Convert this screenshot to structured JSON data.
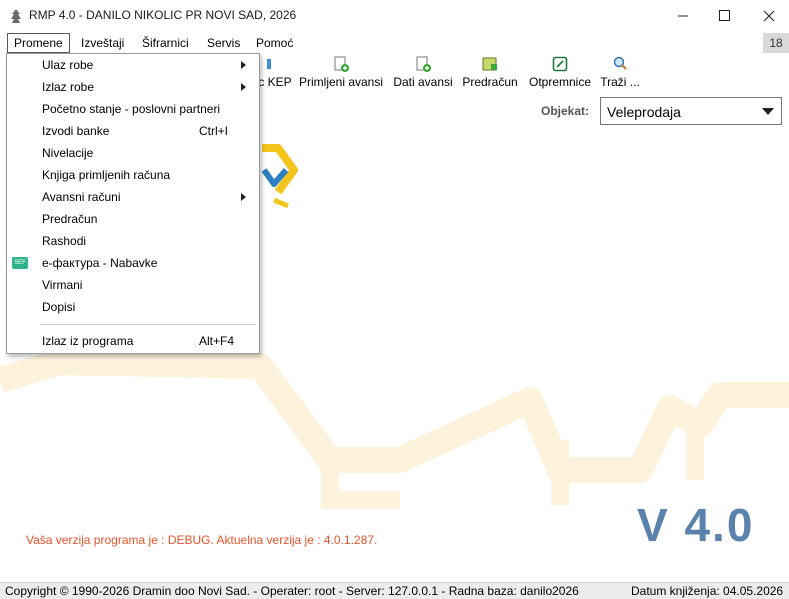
{
  "window": {
    "title": "RMP 4.0 - DANILO NIKOLIC PR NOVI SAD, 2026",
    "minimize_icon": "minimize-icon",
    "maximize_icon": "maximize-icon",
    "close_icon": "close-icon"
  },
  "menubar": {
    "items": [
      {
        "label": "Promene",
        "active": true
      },
      {
        "label": "Izveštaji"
      },
      {
        "label": "Šifrarnici"
      },
      {
        "label": "Servis"
      },
      {
        "label": "Pomoć"
      }
    ],
    "counter": "18"
  },
  "toolbar": {
    "items": [
      {
        "label": "c KEP",
        "icon": "kep-icon"
      },
      {
        "label": "Primljeni avansi",
        "icon": "document-add-icon"
      },
      {
        "label": "Dati avansi",
        "icon": "document-add-icon"
      },
      {
        "label": "Predračun",
        "icon": "invoice-icon"
      },
      {
        "label": "Otpremnice",
        "icon": "delivery-note-icon"
      },
      {
        "label": "Traži ...",
        "icon": "search-icon"
      }
    ]
  },
  "object_selector": {
    "label": "Objekat:",
    "value": "Veleprodaja"
  },
  "dropdown": {
    "items": [
      {
        "label": "Ulaz robe",
        "submenu": true
      },
      {
        "label": "Izlaz robe",
        "submenu": true
      },
      {
        "label": "Početno stanje - poslovni partneri"
      },
      {
        "label": "Izvodi banke",
        "shortcut": "Ctrl+I"
      },
      {
        "label": "Nivelacije"
      },
      {
        "label": "Knjiga primljenih računa"
      },
      {
        "label": "Avansni računi",
        "submenu": true
      },
      {
        "label": "Predračun"
      },
      {
        "label": "Rashodi"
      },
      {
        "label": "е-фактура - Nabavke",
        "icon": "e-invoice-icon"
      },
      {
        "label": "Virmani"
      },
      {
        "label": "Dopisi"
      },
      {
        "label": "Izlaz iz programa",
        "shortcut": "Alt+F4"
      }
    ]
  },
  "main": {
    "version_big": "V 4.0",
    "version_note": "Vaša verzija programa je : DEBUG. Aktuelna verzija je : 4.0.1.287."
  },
  "statusbar": {
    "left": "Copyright © 1990-2026 Dramin doo Novi Sad. - Operater: root - Server: 127.0.0.1 - Radna baza: danilo2026",
    "right": "Datum knjiženja: 04.05.2026"
  },
  "colors": {
    "accent_version": "#5b82ad",
    "version_note": "#e8532a",
    "watermark": "#fdf3dc",
    "logo_yellow": "#f3c41c",
    "logo_blue": "#2e7fbf"
  }
}
